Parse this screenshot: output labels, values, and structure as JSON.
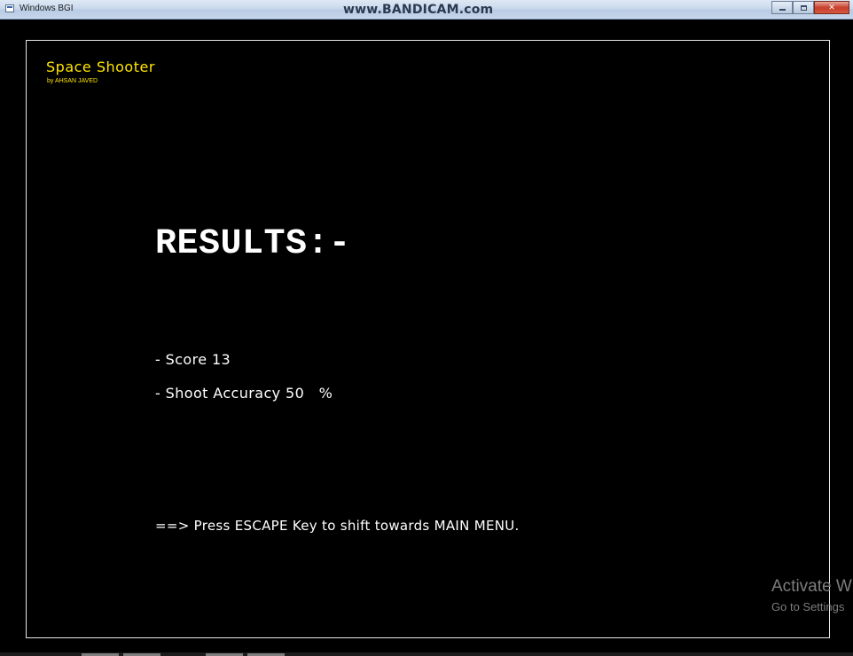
{
  "window": {
    "title": "Windows BGI",
    "watermark": "www.BANDICAM.com"
  },
  "game": {
    "title": "Space Shooter",
    "author": "by AHSAN JAVED",
    "results_heading": "RESULTS:-",
    "score_line": "- Score 13",
    "accuracy_line": "- Shoot Accuracy 50   %",
    "instruction": "==> Press ESCAPE Key to shift towards MAIN MENU."
  },
  "os_overlay": {
    "activate_title": "Activate W",
    "activate_sub": "Go to Settings"
  },
  "colors": {
    "background": "#000000",
    "title_yellow": "#ffe500",
    "text_white": "#ffffff",
    "watermark_gray": "#7d7d7d"
  }
}
